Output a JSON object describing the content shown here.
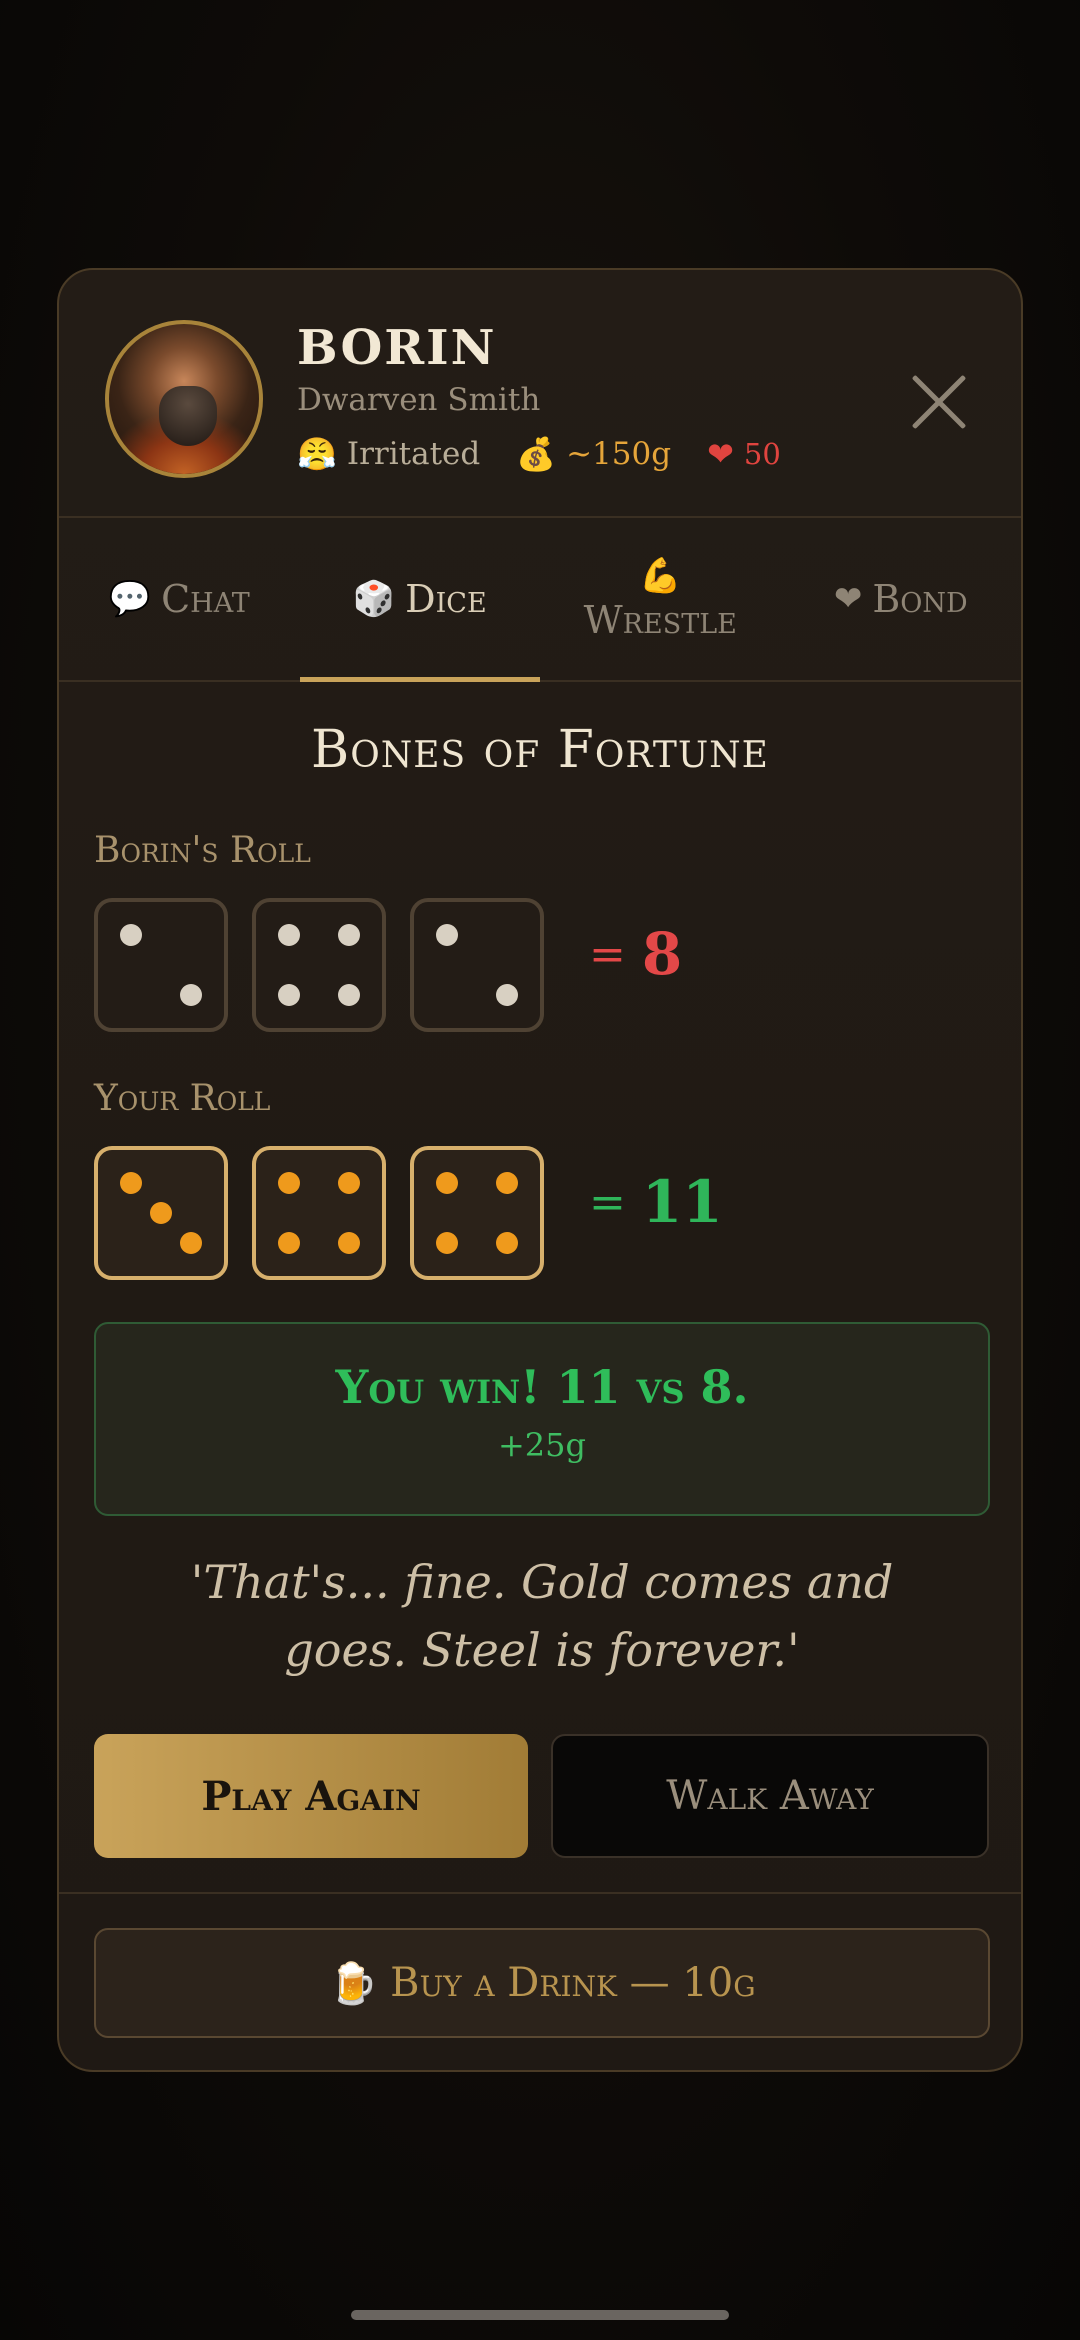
{
  "npc": {
    "name": "BORIN",
    "title": "Dwarven Smith",
    "mood_icon": "😤",
    "mood": "Irritated",
    "gold_icon": "💰",
    "gold": "~150g",
    "heart_icon": "❤",
    "affection": "50"
  },
  "tabs": [
    {
      "icon": "💬",
      "label": "Chat"
    },
    {
      "icon": "🎲",
      "label": "Dice"
    },
    {
      "icon": "💪",
      "label": "Wrestle"
    },
    {
      "icon": "❤",
      "label": "Bond"
    }
  ],
  "active_tab": "Dice",
  "game": {
    "title": "Bones of Fortune",
    "npc_roll_label": "Borin's Roll",
    "npc_dice": [
      2,
      4,
      2
    ],
    "npc_eq": "=",
    "npc_total": "8",
    "your_roll_label": "Your Roll",
    "your_dice": [
      3,
      4,
      4
    ],
    "your_eq": "=",
    "your_total": "11",
    "result": "You win! 11 vs 8.",
    "reward": "+25g",
    "quote": "'That's... fine. Gold comes and goes. Steel is forever.'"
  },
  "actions": {
    "play_again": "Play Again",
    "walk_away": "Walk Away",
    "drink_icon": "🍺",
    "buy_drink": "Buy a Drink — 10g"
  },
  "colors": {
    "accent_gold": "#c9a35a",
    "win_green": "#2fb55a",
    "lose_red": "#e34848",
    "die_pip_you": "#ef9a1c"
  }
}
